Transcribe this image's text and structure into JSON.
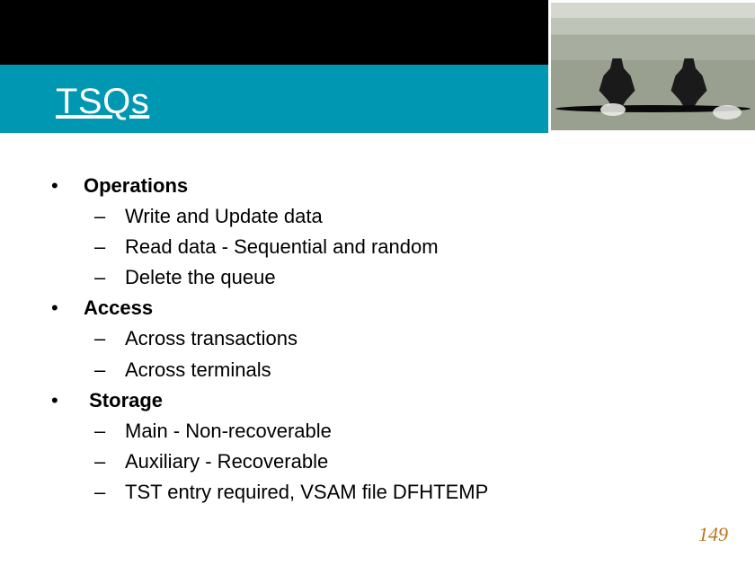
{
  "title": "TSQs",
  "sections": [
    {
      "label": "Operations",
      "items": [
        "Write and Update data",
        "Read data - Sequential and random",
        "Delete the queue"
      ]
    },
    {
      "label": "Access",
      "items": [
        "Across transactions",
        "Across terminals"
      ]
    },
    {
      "label": "Storage",
      "items": [
        "Main - Non-recoverable",
        "Auxiliary - Recoverable",
        "TST entry required, VSAM file DFHTEMP"
      ]
    }
  ],
  "pageNumber": "149"
}
